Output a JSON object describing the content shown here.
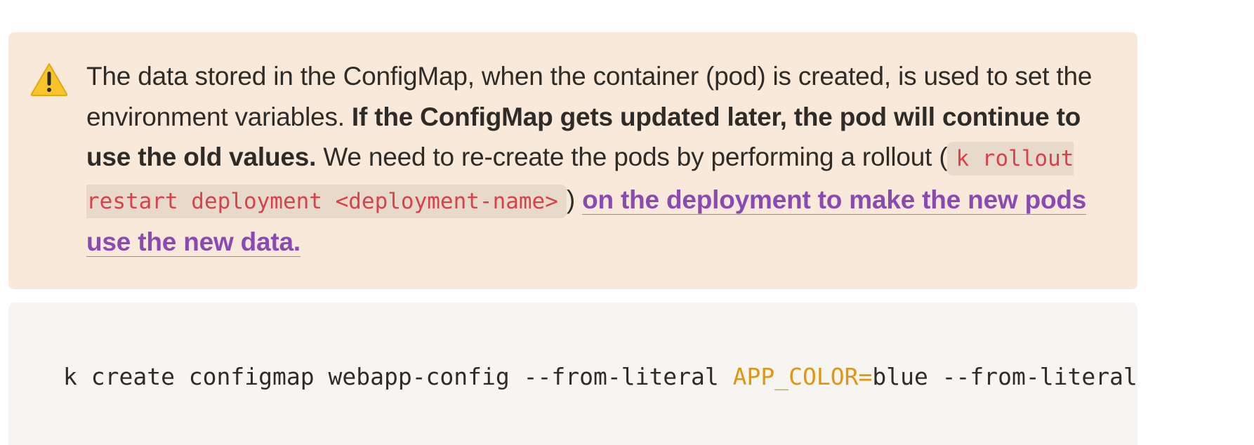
{
  "callout": {
    "icon": "warning-icon",
    "text_part1": "The data stored in the ConfigMap, when the container (pod) is created, is used to set the environment variables. ",
    "bold_text": "If the ConfigMap gets updated later, the pod will continue to use the old values.",
    "text_part2": " We need to re-create the pods by performing a rollout (",
    "inline_code": "k rollout restart deployment <deployment-name>",
    "text_part3": ") ",
    "link_text": "on the deployment to make the new pods use the new data. ",
    "accent_color": "#8a4bb0",
    "background_color": "#f9e9da"
  },
  "code_block": {
    "cmd_prefix": "k create configmap webapp-config --from-literal ",
    "key": "APP_COLOR",
    "operator": "=",
    "value_suffix": "blue --from-literal",
    "key_color": "#e0960d"
  }
}
